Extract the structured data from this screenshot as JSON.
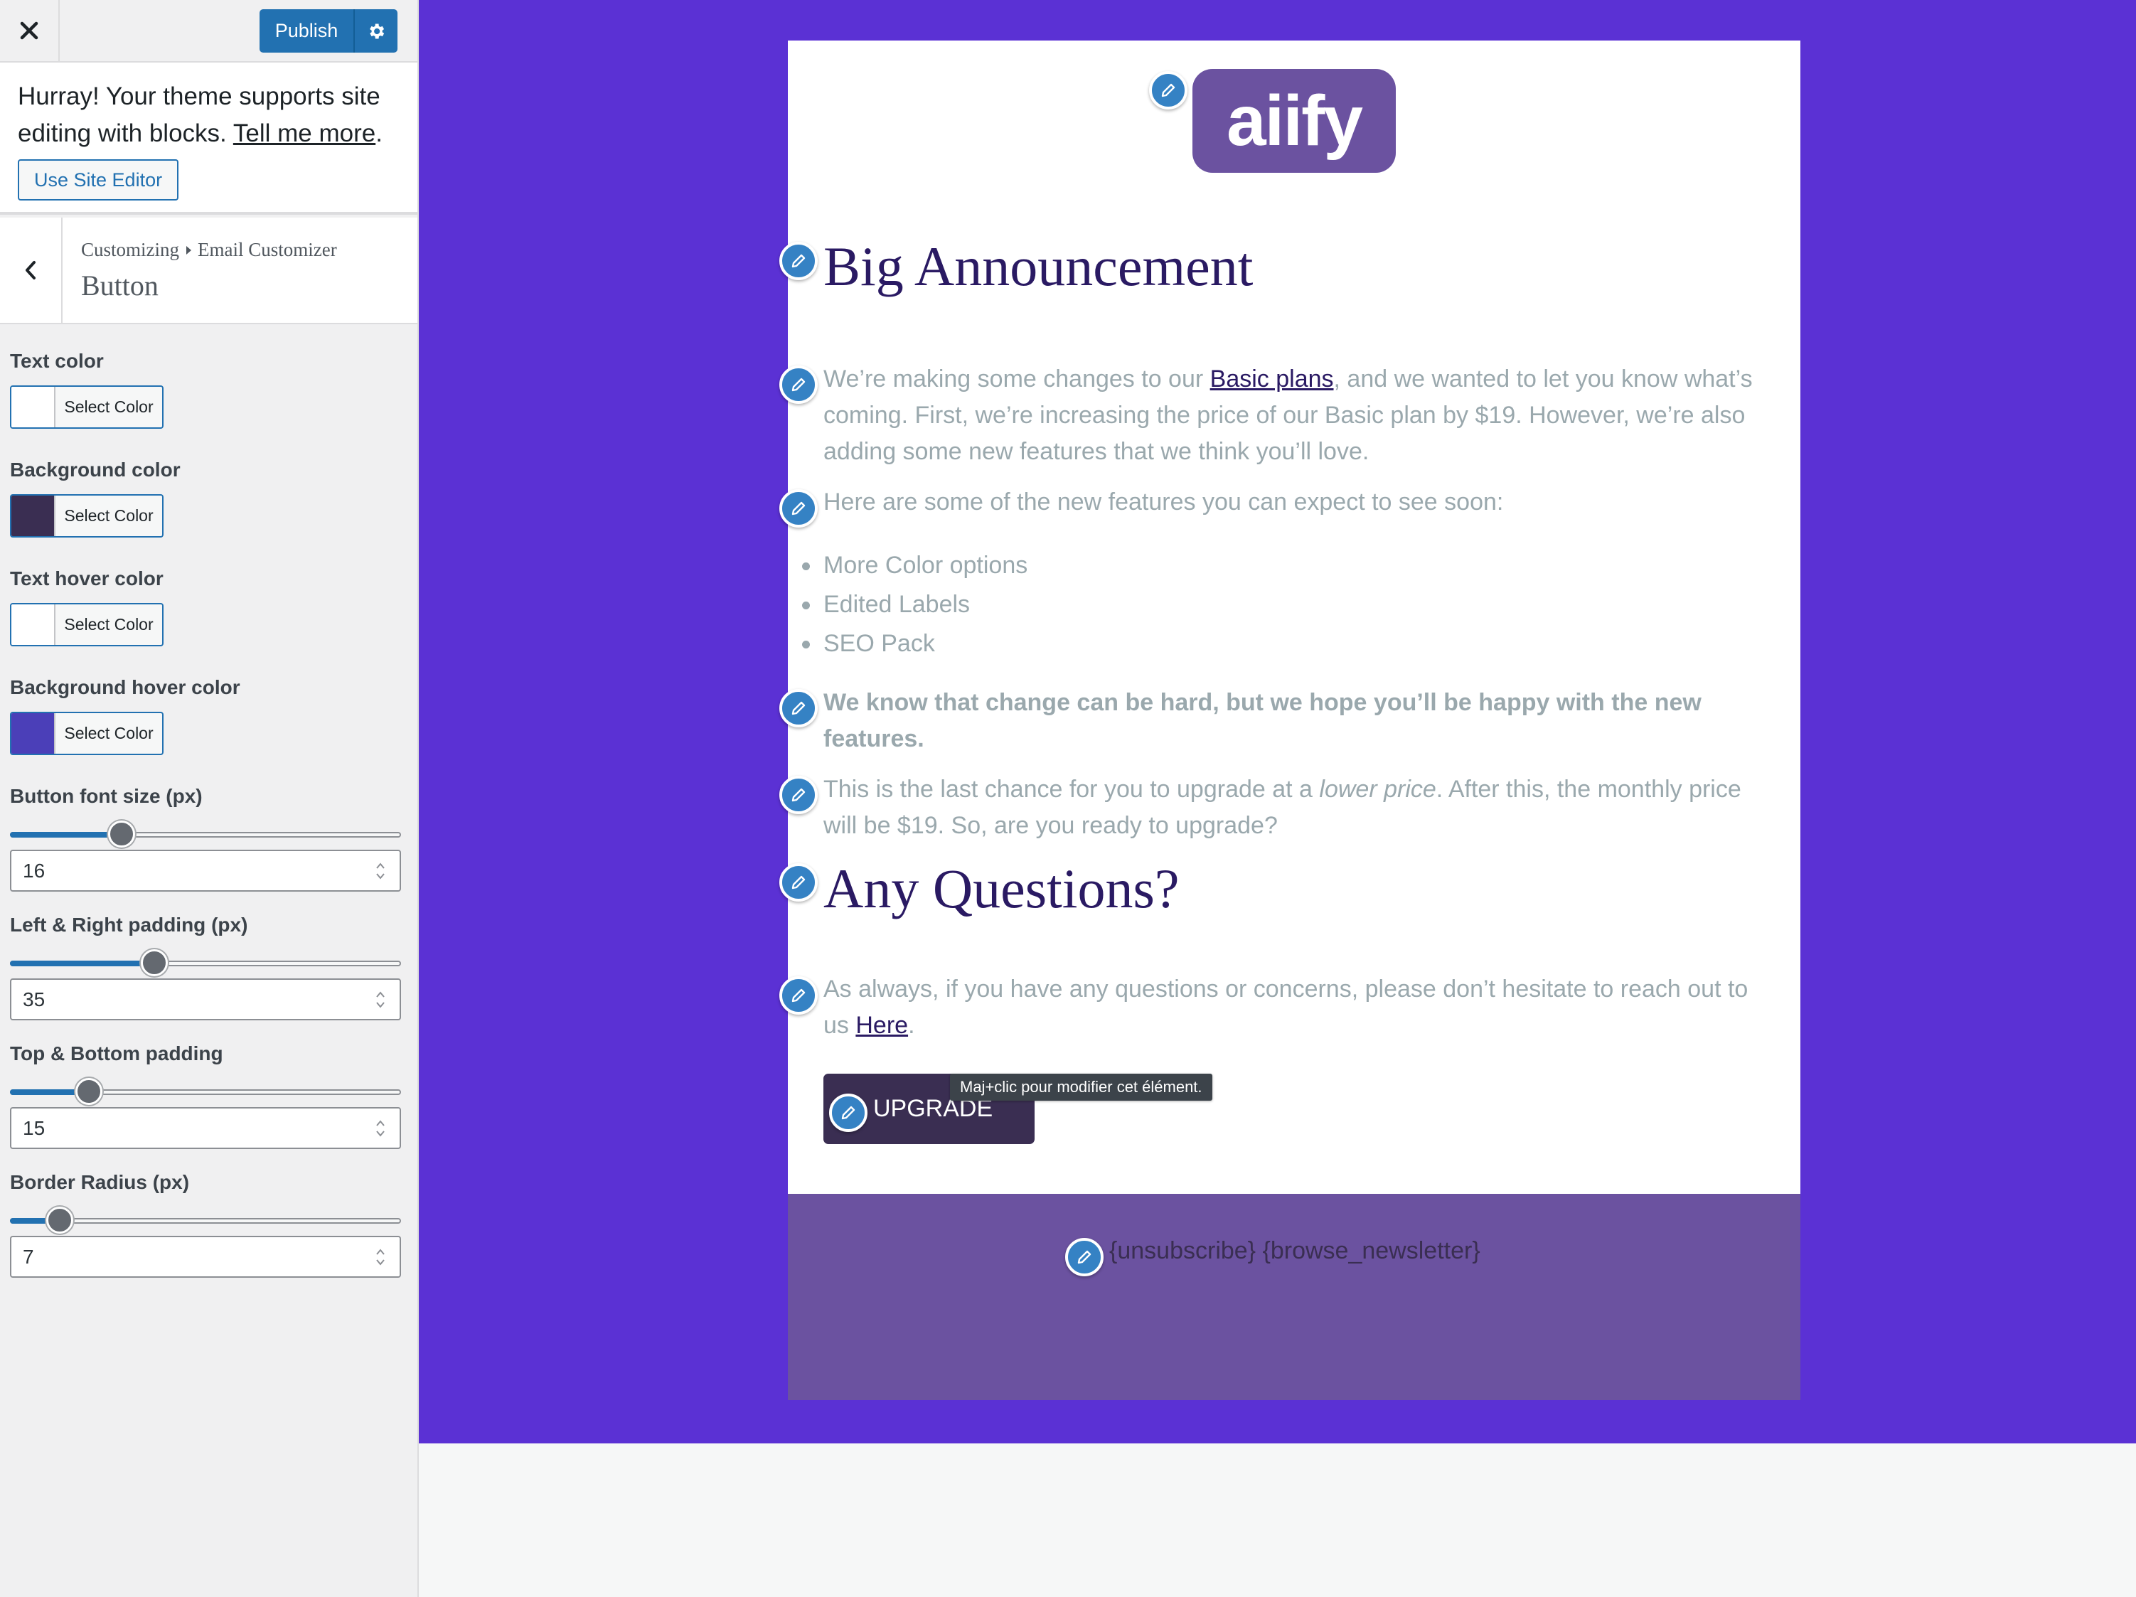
{
  "sidebar": {
    "publish_label": "Publish",
    "notice": {
      "text_before": "Hurray! Your theme supports site editing with blocks.",
      "link": "Tell me more",
      "text_after": ".",
      "button": "Use Site Editor"
    },
    "breadcrumb": [
      "Customizing",
      "Email Customizer"
    ],
    "section_title": "Button",
    "color_controls": [
      {
        "label": "Text color",
        "button": "Select Color",
        "color": "#ffffff"
      },
      {
        "label": "Background color",
        "button": "Select Color",
        "color": "#3a2e52"
      },
      {
        "label": "Text hover color",
        "button": "Select Color",
        "color": "#ffffff"
      },
      {
        "label": "Background hover color",
        "button": "Select Color",
        "color": "#4b3fb8"
      }
    ],
    "range_controls": [
      {
        "label": "Button font size (px)",
        "value": "16",
        "fraction": 0.27
      },
      {
        "label": "Left & Right padding (px)",
        "value": "35",
        "fraction": 0.36
      },
      {
        "label": "Top & Bottom padding",
        "value": "15",
        "fraction": 0.18
      },
      {
        "label": "Border Radius (px)",
        "value": "7",
        "fraction": 0.1
      }
    ]
  },
  "email": {
    "logo_text": "aiify",
    "title": "Big Announcement",
    "intro": {
      "before": "We’re making some changes to our ",
      "link": "Basic plans",
      "after": ", and we wanted to let you know what’s coming. First, we’re increasing the price of our Basic plan by $19. However, we’re also adding some new features that we think you’ll love."
    },
    "features_intro": "Here are some of the new features you can expect to see soon:",
    "features": [
      "More Color options",
      "Edited Labels",
      "SEO Pack"
    ],
    "bold_note": "We know that change can be hard, but we hope you’ll be happy with the new features.",
    "last_chance": {
      "before": "This is the last chance for you to upgrade at a ",
      "em": "lower price",
      "after": ". After this, the monthly price will be $19. So, are you ready to upgrade?"
    },
    "questions_title": "Any Questions?",
    "questions": {
      "before": "As always, if you have any questions or concerns, please don’t hesitate to reach out to us ",
      "link": "Here",
      "after": "."
    },
    "button_label": "UPGRADE",
    "tooltip": "Maj+clic pour modifier cet élément.",
    "footer_links": "{unsubscribe} {browse_newsletter}"
  },
  "colors": {
    "preview_background": "#5b31d4",
    "footer_background": "#6b52a0",
    "heading": "#2a1a63",
    "body_text": "#9aa8ad",
    "accent": "#2271b1"
  },
  "icons": [
    "close-icon",
    "gear-icon",
    "chevron-left-icon",
    "caret-right-icon",
    "pencil-icon",
    "stepper-icon"
  ]
}
